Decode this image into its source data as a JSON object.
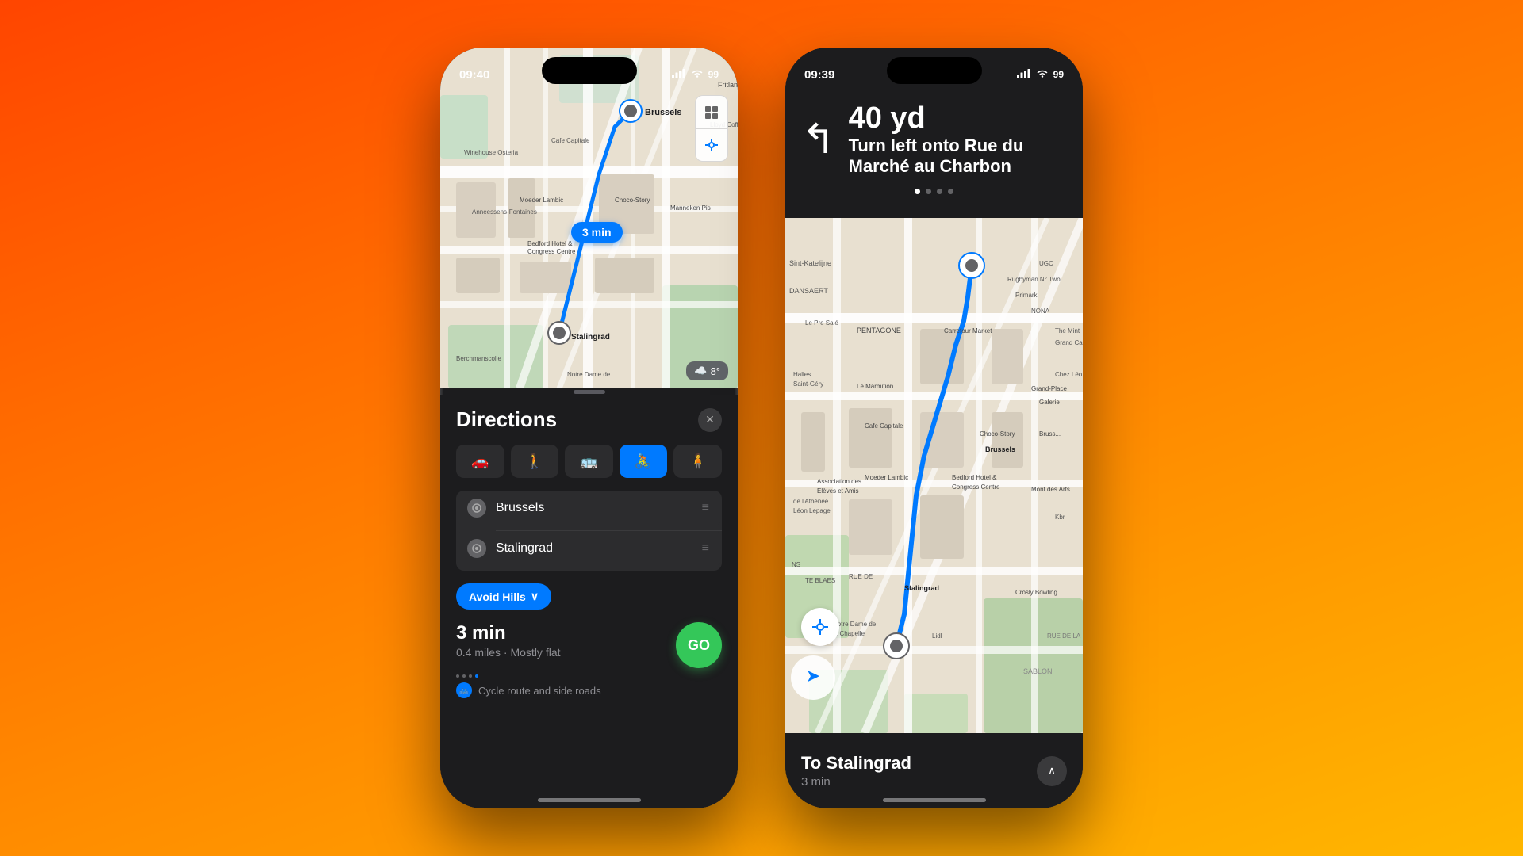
{
  "background": {
    "gradient_start": "#ff4500",
    "gradient_end": "#ffb700"
  },
  "phone1": {
    "status_bar": {
      "time": "09:40",
      "location_arrow": "▸",
      "signal_bars": "▌▌▌",
      "wifi": "wifi",
      "battery": "99"
    },
    "map": {
      "time_badge": "3 min",
      "weather": "8°"
    },
    "directions_panel": {
      "title": "Directions",
      "close_label": "✕",
      "transport_modes": [
        {
          "icon": "🚗",
          "label": "car",
          "active": false
        },
        {
          "icon": "🚶",
          "label": "walk",
          "active": false
        },
        {
          "icon": "🚌",
          "label": "transit",
          "active": false
        },
        {
          "icon": "🚴",
          "label": "cycle",
          "active": true
        },
        {
          "icon": "🧍",
          "label": "custom",
          "active": false
        }
      ],
      "from_location": "Brussels",
      "to_location": "Stalingrad",
      "avoid_btn_label": "Avoid Hills",
      "avoid_btn_chevron": "∨",
      "route": {
        "time": "3 min",
        "distance": "0.4 miles",
        "terrain": "Mostly flat",
        "route_type": "Cycle route and side roads",
        "go_label": "GO"
      }
    }
  },
  "phone2": {
    "status_bar": {
      "time": "09:39",
      "location_arrow": "▸",
      "signal_bars": "▌▌▌",
      "wifi": "wifi",
      "battery": "99"
    },
    "navigation": {
      "distance": "40 yd",
      "instruction": "Turn left onto Rue du Marché au Charbon",
      "turn_arrow": "↰",
      "dots": [
        {
          "active": true
        },
        {
          "active": false
        },
        {
          "active": false
        },
        {
          "active": false
        }
      ]
    },
    "destination_bar": {
      "label": "To Stalingrad",
      "eta": "3 min",
      "expand_icon": "∧"
    }
  }
}
